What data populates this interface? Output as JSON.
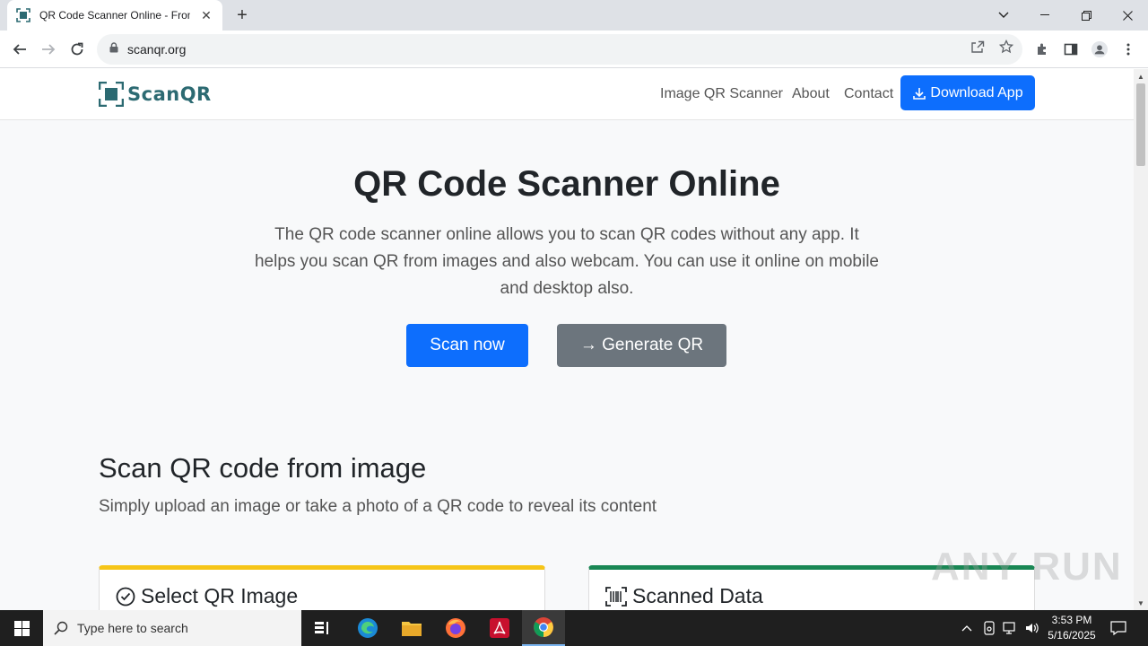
{
  "browser": {
    "tab_title": "QR Code Scanner Online - From",
    "url": "scanqr.org"
  },
  "site": {
    "logo_text": "ScanQR",
    "nav": {
      "image_scanner": "Image QR Scanner",
      "about": "About",
      "contact": "Contact",
      "download": "Download App"
    },
    "hero": {
      "title": "QR Code Scanner Online",
      "description": "The QR code scanner online allows you to scan QR codes without any app. It helps you scan QR from images and also webcam. You can use it online on mobile and desktop also.",
      "scan_button": "Scan now",
      "generate_button": "→ Generate QR"
    },
    "section": {
      "title": "Scan QR code from image",
      "subtitle": "Simply upload an image or take a photo of a QR code to reveal its content"
    },
    "cards": {
      "select_title": "Select QR Image",
      "scanned_title": "Scanned Data"
    },
    "colors": {
      "primary": "#0d6efd",
      "secondary": "#6c757d",
      "logo": "#2c6a72",
      "card_yellow": "#f6c518",
      "card_green": "#198754"
    }
  },
  "watermark": "ANY RUN",
  "taskbar": {
    "search_placeholder": "Type here to search",
    "time": "3:53 PM",
    "date": "5/16/2025"
  }
}
